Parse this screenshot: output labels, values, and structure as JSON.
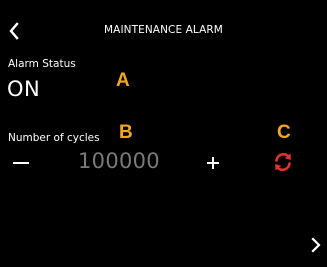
{
  "header": {
    "title": "MAINTENANCE ALARM",
    "back_icon": "chevron-left-icon"
  },
  "alarm_status": {
    "label": "Alarm Status",
    "value": "ON"
  },
  "cycles": {
    "label": "Number of cycles",
    "value": "100000",
    "decrement_label": "−",
    "increment_label": "+",
    "reset_icon": "reset-icon"
  },
  "callouts": {
    "a": "A",
    "b": "B",
    "c": "C"
  },
  "footer": {
    "next_icon": "chevron-right-icon"
  },
  "colors": {
    "background": "#000000",
    "text": "#ffffff",
    "value_muted": "#7a7a7a",
    "callout": "#f5a623",
    "reset_icon": "#e8312f"
  }
}
